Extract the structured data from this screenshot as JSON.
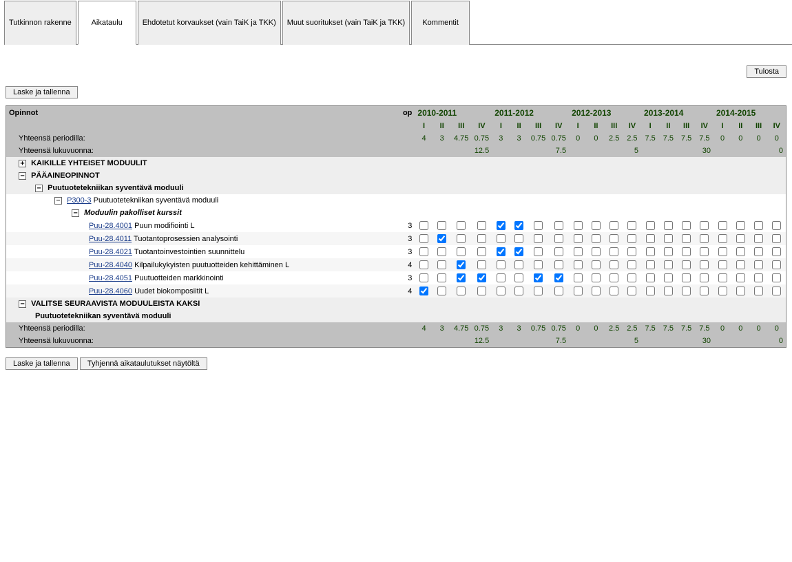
{
  "tabs": [
    {
      "label": "Tutkinnon rakenne"
    },
    {
      "label": "Aikataulu"
    },
    {
      "label": "Ehdotetut korvaukset (vain TaiK ja TKK)"
    },
    {
      "label": "Muut suoritukset (vain TaiK ja TKK)"
    },
    {
      "label": "Kommentit"
    }
  ],
  "buttons": {
    "print": "Tulosta",
    "save": "Laske ja tallenna",
    "clear": "Tyhjennä aikataulutukset näytöltä"
  },
  "headers": {
    "opinnot": "Opinnot",
    "op": "op",
    "yhteensa_periodilla": "Yhteensä periodilla:",
    "yhteensa_lukuvuonna": "Yhteensä lukuvuonna:"
  },
  "years": [
    "2010-2011",
    "2011-2012",
    "2012-2013",
    "2013-2014",
    "2014-2015"
  ],
  "periods": [
    "I",
    "II",
    "III",
    "IV"
  ],
  "period_sums": [
    [
      "4",
      "3",
      "4.75",
      "0.75"
    ],
    [
      "3",
      "3",
      "0.75",
      "0.75"
    ],
    [
      "0",
      "0",
      "2.5",
      "2.5"
    ],
    [
      "7.5",
      "7.5",
      "7.5",
      "7.5"
    ],
    [
      "0",
      "0",
      "0",
      "0"
    ]
  ],
  "year_sums": [
    "12.5",
    "7.5",
    "5",
    "30",
    "0"
  ],
  "modules": {
    "kaikille": "KAIKILLE YHTEISET MODUULIT",
    "paa": "PÄÄAINEOPINNOT",
    "puu_syv": "Puutuotetekniikan syventävä moduuli",
    "p300_code": "P300-3",
    "p300_name": "Puutuotetekniikan syventävä moduuli",
    "pakolliset": "Moduulin pakolliset kurssit",
    "valitse": "VALITSE SEURAAVISTA MODUULEISTA KAKSI",
    "puu_syv2": "Puutuotetekniikan syventävä moduuli"
  },
  "courses": [
    {
      "code": "Puu-28.4001",
      "name": "Puun modifiointi L",
      "op": "3",
      "checks": [
        [
          false,
          false,
          false,
          false
        ],
        [
          true,
          true,
          false,
          false
        ],
        [
          false,
          false,
          false,
          false
        ],
        [
          false,
          false,
          false,
          false
        ],
        [
          false,
          false,
          false,
          false
        ]
      ]
    },
    {
      "code": "Puu-28.4011",
      "name": "Tuotantoprosessien analysointi",
      "op": "3",
      "checks": [
        [
          false,
          true,
          false,
          false
        ],
        [
          false,
          false,
          false,
          false
        ],
        [
          false,
          false,
          false,
          false
        ],
        [
          false,
          false,
          false,
          false
        ],
        [
          false,
          false,
          false,
          false
        ]
      ]
    },
    {
      "code": "Puu-28.4021",
      "name": "Tuotantoinvestointien suunnittelu",
      "op": "3",
      "checks": [
        [
          false,
          false,
          false,
          false
        ],
        [
          true,
          true,
          false,
          false
        ],
        [
          false,
          false,
          false,
          false
        ],
        [
          false,
          false,
          false,
          false
        ],
        [
          false,
          false,
          false,
          false
        ]
      ]
    },
    {
      "code": "Puu-28.4040",
      "name": "Kilpailukykyisten puutuotteiden kehittäminen L",
      "op": "4",
      "checks": [
        [
          false,
          false,
          true,
          false
        ],
        [
          false,
          false,
          false,
          false
        ],
        [
          false,
          false,
          false,
          false
        ],
        [
          false,
          false,
          false,
          false
        ],
        [
          false,
          false,
          false,
          false
        ]
      ]
    },
    {
      "code": "Puu-28.4051",
      "name": "Puutuotteiden markkinointi",
      "op": "3",
      "checks": [
        [
          false,
          false,
          true,
          true
        ],
        [
          false,
          false,
          true,
          true
        ],
        [
          false,
          false,
          false,
          false
        ],
        [
          false,
          false,
          false,
          false
        ],
        [
          false,
          false,
          false,
          false
        ]
      ]
    },
    {
      "code": "Puu-28.4060",
      "name": "Uudet biokomposiitit L",
      "op": "4",
      "checks": [
        [
          true,
          false,
          false,
          false
        ],
        [
          false,
          false,
          false,
          false
        ],
        [
          false,
          false,
          false,
          false
        ],
        [
          false,
          false,
          false,
          false
        ],
        [
          false,
          false,
          false,
          false
        ]
      ]
    }
  ]
}
